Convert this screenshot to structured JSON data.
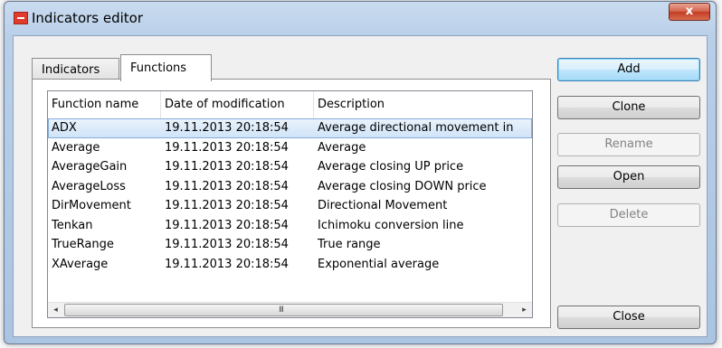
{
  "window": {
    "title": "Indicators editor",
    "close_label": "x"
  },
  "tabs": [
    {
      "label": "Indicators",
      "active": false
    },
    {
      "label": "Functions",
      "active": true
    }
  ],
  "table": {
    "columns": [
      "Function name",
      "Date of modification",
      "Description"
    ],
    "rows": [
      {
        "name": "ADX",
        "date": "19.11.2013 20:18:54",
        "description": "Average directional movement in",
        "selected": true
      },
      {
        "name": "Average",
        "date": "19.11.2013 20:18:54",
        "description": "Average"
      },
      {
        "name": "AverageGain",
        "date": "19.11.2013 20:18:54",
        "description": "Average closing UP price"
      },
      {
        "name": "AverageLoss",
        "date": "19.11.2013 20:18:54",
        "description": "Average closing DOWN price"
      },
      {
        "name": "DirMovement",
        "date": "19.11.2013 20:18:54",
        "description": "Directional Movement"
      },
      {
        "name": "Tenkan",
        "date": "19.11.2013 20:18:54",
        "description": "Ichimoku conversion line"
      },
      {
        "name": "TrueRange",
        "date": "19.11.2013 20:18:54",
        "description": "True range"
      },
      {
        "name": "XAverage",
        "date": "19.11.2013 20:18:54",
        "description": "Exponential average"
      }
    ]
  },
  "buttons": {
    "add": "Add",
    "clone": "Clone",
    "rename": "Rename",
    "open": "Open",
    "delete": "Delete",
    "close": "Close"
  },
  "scrollbar": {
    "left_arrow": "◂",
    "right_arrow": "▸",
    "grip": "III"
  }
}
